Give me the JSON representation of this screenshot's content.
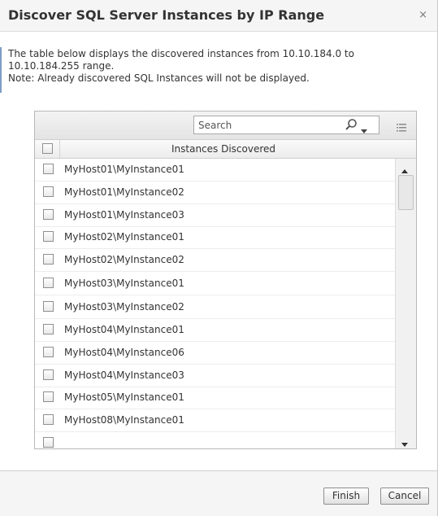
{
  "dialog": {
    "title": "Discover SQL Server Instances by IP Range",
    "close_glyph": "×"
  },
  "description": {
    "line1": "The table below displays the discovered instances from 10.10.184.0 to",
    "line2": "10.10.184.255 range.",
    "line3": "Note: Already discovered SQL Instances will not be displayed."
  },
  "toolbar": {
    "search_placeholder": "Search",
    "search_icon": "search-icon",
    "columns_icon": "columns-icon"
  },
  "table": {
    "column_header": "Instances Discovered",
    "rows": [
      {
        "label": "MyHost01\\MyInstance01",
        "checked": false
      },
      {
        "label": "MyHost01\\MyInstance02",
        "checked": false
      },
      {
        "label": "MyHost01\\MyInstance03",
        "checked": false
      },
      {
        "label": "MyHost02\\MyInstance01",
        "checked": false
      },
      {
        "label": "MyHost02\\MyInstance02",
        "checked": false
      },
      {
        "label": "MyHost03\\MyInstance01",
        "checked": false
      },
      {
        "label": "MyHost03\\MyInstance02",
        "checked": false
      },
      {
        "label": "MyHost04\\MyInstance01",
        "checked": false
      },
      {
        "label": "MyHost04\\MyInstance06",
        "checked": false
      },
      {
        "label": "MyHost04\\MyInstance03",
        "checked": false
      },
      {
        "label": "MyHost05\\MyInstance01",
        "checked": false
      },
      {
        "label": "MyHost08\\MyInstance01",
        "checked": false
      },
      {
        "label": "",
        "checked": false
      }
    ]
  },
  "buttons": {
    "finish": "Finish",
    "cancel": "Cancel"
  }
}
